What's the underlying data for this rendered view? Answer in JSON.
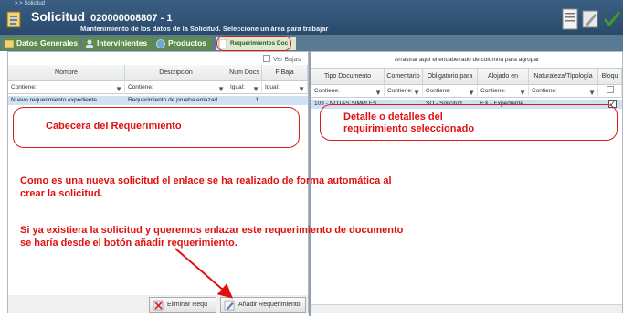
{
  "header": {
    "breadcrumb": "> > Solicitud",
    "title": "Solicitud",
    "number": "020000008807 - 1",
    "subtitle": "Mantenimiento de los datos de la Solicitud. Seleccione un área para trabajar"
  },
  "tabs": [
    {
      "label": "Datos Generales"
    },
    {
      "label": "Intervinientes"
    },
    {
      "label": "Productos"
    },
    {
      "label": "Requerimientos Doc"
    }
  ],
  "left_grid": {
    "ver_bajas": "Ver Bajas",
    "columns": [
      "Nombre",
      "Descripción",
      "Num Docs",
      "F Baja"
    ],
    "filters": [
      "Contiene:",
      "Contiene:",
      "Igual:",
      "Igual:"
    ],
    "rows": [
      {
        "nombre": "Nuevo requerimiento expediente",
        "descripcion": "Requerimiento de prueba enlazad...",
        "num_docs": "1",
        "f_baja": ""
      }
    ],
    "buttons": {
      "eliminar": "Eliminar Requ",
      "anadir": "Añadir Requerimiento"
    }
  },
  "right_grid": {
    "group_hint": "Arrastrar aquí el encabezado de columna para agrupar",
    "columns": [
      "Tipo Documento",
      "Comentario",
      "Obligatorio para",
      "Alojado en",
      "Naturaleza/Tipología",
      "Bloqu"
    ],
    "filters": [
      "Contiene:",
      "Contiene:",
      "Contiene:",
      "Contiene:",
      "Contiene:"
    ],
    "rows": [
      {
        "tipo": "103 - NOTAS SIMPLES",
        "comentario": "",
        "obligatorio": "SO - Solicitud",
        "alojado": "EX - Expediente",
        "naturaleza": ""
      }
    ]
  },
  "annotations": {
    "cabecera": "Cabecera del Requerimiento",
    "detalle_1": "Detalle o detalles del",
    "detalle_2": "requirimiento seleccionado",
    "nota_1a": "Como es una nueva solicitud el enlace se ha realizado de forma automática al",
    "nota_1b": "crear la solicitud.",
    "nota_2a": "Si ya existiera la solicitud y queremos enlazar este requerimiento de documento",
    "nota_2b": "se haría desde el botón añadir requerimiento."
  },
  "colors": {
    "header": "#2f5377",
    "tab_green": "#5f8b4d",
    "selected_row": "#cfe2f3",
    "annotation": "#e01010"
  }
}
